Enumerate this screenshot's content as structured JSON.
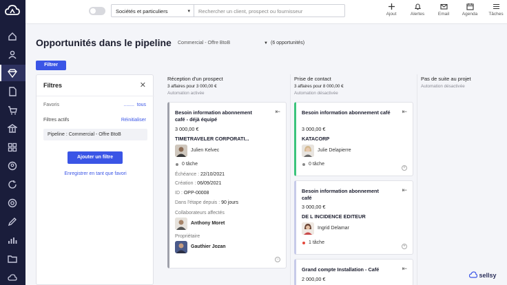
{
  "topbar": {
    "segment": "Sociétés et particuliers",
    "search_placeholder": "Rechercher un client, prospect ou fournisseur",
    "actions": [
      {
        "label": "Ajout",
        "icon": "plus-icon"
      },
      {
        "label": "Alertes",
        "icon": "bell-icon"
      },
      {
        "label": "Email",
        "icon": "mail-icon"
      },
      {
        "label": "Agenda",
        "icon": "calendar-icon"
      },
      {
        "label": "Tâches",
        "icon": "list-icon"
      }
    ]
  },
  "header": {
    "title": "Opportunités dans le pipeline",
    "pipeline": "Commercial - Offre BtoB",
    "count": "(6 opportunités)",
    "filter_button": "Filtrer"
  },
  "filters": {
    "title": "Filtres",
    "favorites_label": "Favoris",
    "favorites_dots": "........",
    "favorites_all": "tous",
    "active_label": "Filtres actifs",
    "reset": "Réinitialiser",
    "active_chip": "Pipeline : Commercial - Offre BtoB",
    "add_button": "Ajouter un filtre",
    "save_link": "Enregistrer en tant que favori"
  },
  "columns": [
    {
      "title": "Réception d'un prospect",
      "summary": "3 affaires pour 3 000,00 €",
      "automation": "Automation activée"
    },
    {
      "title": "Prise de contact",
      "summary": "3 affaires pour 8 000,00 €",
      "automation": "Automation désactivée"
    },
    {
      "title": "Pas de suite au projet",
      "summary": "",
      "automation": "Automation désactivée"
    }
  ],
  "cards": {
    "c1": {
      "name1": "Besoin information abonnement",
      "name2": "café - déjà équipé",
      "amount": "3 000,00 €",
      "company": "TIMETRAVELER CORPORATI...",
      "person": "Julien Kelvec",
      "task": "0 tâche",
      "due_label": "Échéance : ",
      "due": "22/10/2021",
      "created_label": "Création : ",
      "created": "06/09/2021",
      "id_label": "ID : ",
      "id": "OPP-00008",
      "stage_label": "Dans l'étape depuis : ",
      "stage": "90 jours",
      "collab_label": "Collaborateurs affectés",
      "collab": "Anthony Moret",
      "owner_label": "Propriétaire",
      "owner": "Gauthier Jozan"
    },
    "c2": {
      "name": "Besoin information abonnement café",
      "amount": "3 000,00 €",
      "company": "KATACORP",
      "person": "Julie Delapierre",
      "task": "0 tâche"
    },
    "c3": {
      "name1": "Besoin information abonnement",
      "name2": "café",
      "amount": "3 000,00 €",
      "company": "DE L INCIDENCE EDITEUR",
      "person": "Ingrid Delamar",
      "task": "1 tâche"
    },
    "c4": {
      "name": "Grand compte Installation - Café",
      "amount": "2 000,00 €"
    }
  },
  "brand": "sellsy",
  "colors": {
    "sidebar": "#1a1d3b",
    "accent": "#3a55e6",
    "green": "#3cc47c",
    "late": "#e5483b"
  }
}
